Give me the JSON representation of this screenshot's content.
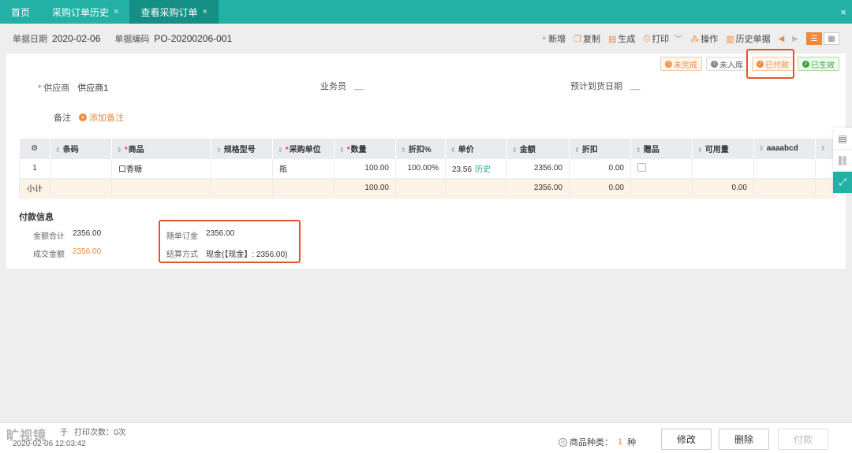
{
  "tabs": [
    {
      "label": "首页",
      "closable": false,
      "active": false
    },
    {
      "label": "采购订单历史",
      "closable": true,
      "active": false
    },
    {
      "label": "查看采购订单",
      "closable": true,
      "active": true
    }
  ],
  "close_symbol": "×",
  "header": {
    "date_label": "单据日期",
    "date_value": "2020-02-06",
    "code_label": "单据编码",
    "code_value": "PO-20200206-001"
  },
  "actions": {
    "new": "新增",
    "copy": "复制",
    "generate": "生成",
    "print": "打印",
    "operate": "操作",
    "history": "历史单据"
  },
  "status_badges": {
    "incomplete": "未完成",
    "not_stored": "未入库",
    "paid": "已付款",
    "effective": "已生效"
  },
  "form": {
    "supplier_label": "供应商",
    "supplier_value": "供应商1",
    "salesman_label": "业务员",
    "salesman_value": "__",
    "delivery_label": "预计到货日期",
    "delivery_value": "__",
    "note_label": "备注",
    "add_note": "添加备注"
  },
  "table": {
    "headers": {
      "barcode": "条码",
      "product": "商品",
      "spec": "规格型号",
      "unit": "采购单位",
      "qty": "数量",
      "discount_pct": "折扣%",
      "price": "单价",
      "amount": "金额",
      "discount": "折扣",
      "gift": "赠品",
      "available": "可用量",
      "custom": "aaaabcd"
    },
    "rows": [
      {
        "index": "1",
        "barcode": "",
        "product": "口香糖",
        "spec": "",
        "unit": "瓶",
        "qty": "100.00",
        "discount_pct": "100.00%",
        "price": "23.56",
        "price_history": "历史",
        "amount": "2356.00",
        "discount": "0.00",
        "available": "",
        "custom": ""
      }
    ],
    "subtotal": {
      "label": "小计",
      "qty": "100.00",
      "amount": "2356.00",
      "discount": "0.00",
      "available": "0.00"
    }
  },
  "payment": {
    "title": "付款信息",
    "total_label": "金额合计",
    "total_value": "2356.00",
    "deal_label": "成交金额",
    "deal_value": "2356.00",
    "deposit_label": "随单订金",
    "deposit_value": "2356.00",
    "method_label": "结算方式",
    "method_value": "现金(【现金】: 2356.00)"
  },
  "footer": {
    "watermark": "旷视镜",
    "creator_suffix": "于",
    "created_time": "2020-02-06 12:03:42",
    "print_count_label": "打印次数：",
    "print_count": "0次",
    "kinds_label": "商品种类：",
    "kinds_count": "1",
    "kinds_unit": "种",
    "edit_button": "修改",
    "delete_button": "删除",
    "pay_button": "付款"
  }
}
